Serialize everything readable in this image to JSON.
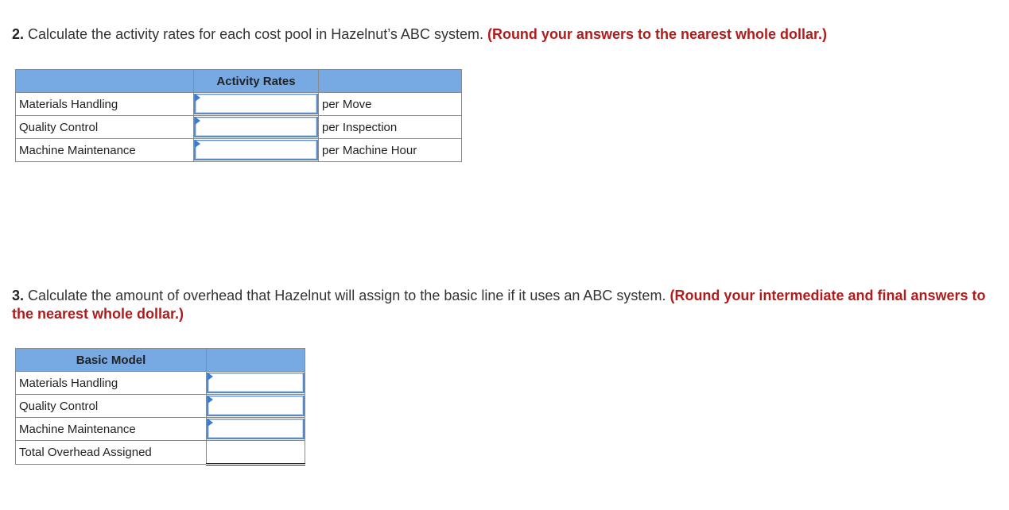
{
  "question2": {
    "number": "2.",
    "text": " Calculate the activity rates for each cost pool in Hazelnut’s ABC system. ",
    "hint": "(Round your answers to the nearest whole dollar.)"
  },
  "table1": {
    "headers": [
      "",
      "Activity Rates",
      ""
    ],
    "rows": [
      {
        "label": "Materials Handling",
        "value": "",
        "unit": "per Move"
      },
      {
        "label": "Quality Control",
        "value": "",
        "unit": "per Inspection"
      },
      {
        "label": "Machine Maintenance",
        "value": "",
        "unit": "per Machine Hour"
      }
    ]
  },
  "question3": {
    "number": "3.",
    "text": " Calculate the amount of overhead that Hazelnut will assign to the basic line if it uses an ABC system. ",
    "hint": "(Round your intermediate and final answers to the nearest whole dollar.)"
  },
  "table2": {
    "headers": [
      "Basic Model",
      ""
    ],
    "rows": [
      {
        "label": "Materials Handling",
        "value": ""
      },
      {
        "label": "Quality Control",
        "value": ""
      },
      {
        "label": "Machine Maintenance",
        "value": ""
      }
    ],
    "total": {
      "label": "Total Overhead Assigned",
      "value": ""
    }
  },
  "colors": {
    "header_bg": "#77aae3",
    "hint_red": "#b01c1c",
    "input_border": "#5b89c4"
  }
}
